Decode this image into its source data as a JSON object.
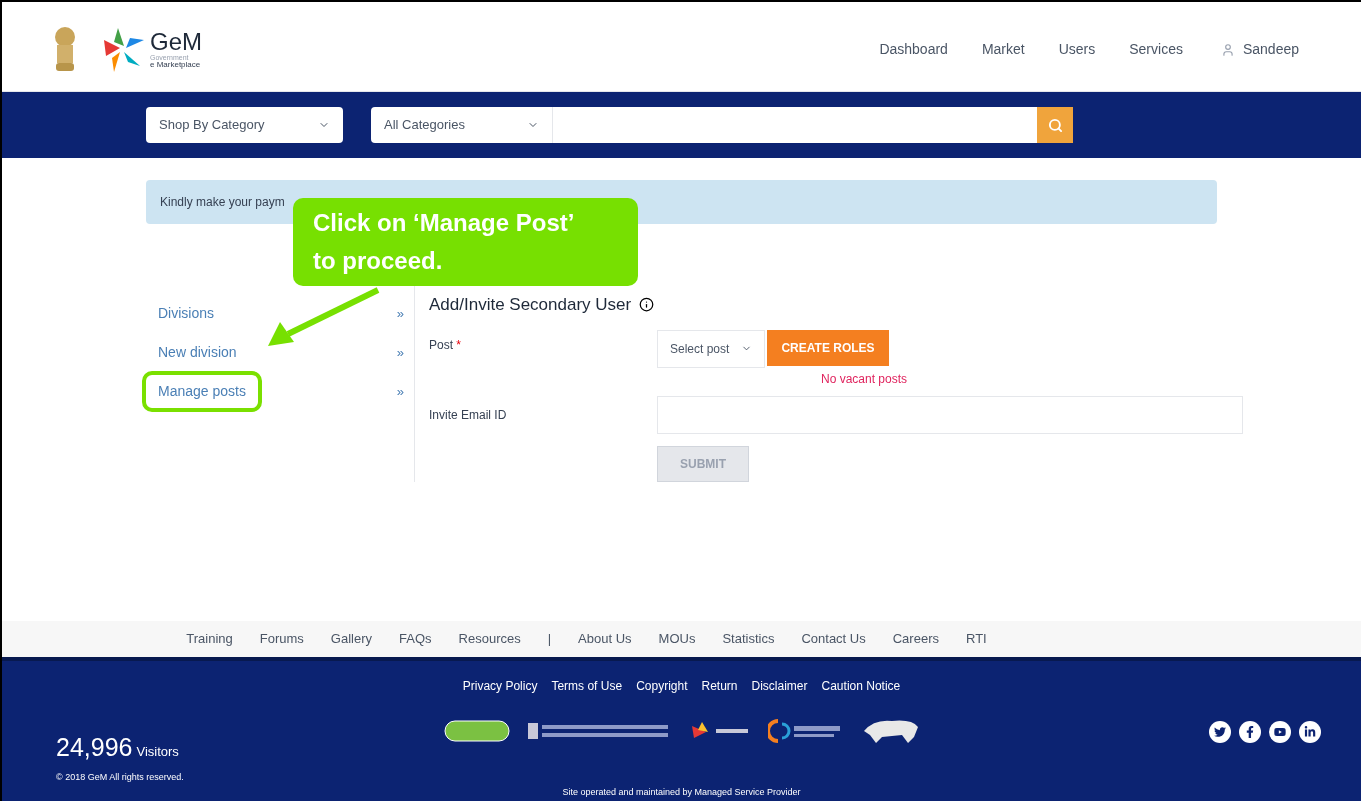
{
  "header": {
    "logo_title": "GeM",
    "logo_subtitle_1": "Government",
    "logo_subtitle_2": "e Marketplace",
    "nav": [
      "Dashboard",
      "Market",
      "Users",
      "Services"
    ],
    "user": "Sandeep"
  },
  "search_bar": {
    "category_dropdown": "Shop By Category",
    "filter_dropdown": "All Categories"
  },
  "notice": "Kindly make your paym",
  "callout": {
    "line_1": "Click on ‘Manage Post’",
    "line_2": "to proceed."
  },
  "sidebar": {
    "items": [
      {
        "label": "Divisions",
        "chevron": "»",
        "highlighted": false
      },
      {
        "label": "New division",
        "chevron": "»",
        "highlighted": false
      },
      {
        "label": "Manage posts",
        "chevron": "»",
        "highlighted": true
      }
    ]
  },
  "form": {
    "heading": "Add/Invite Secondary User",
    "post_label": "Post",
    "required_mark": "*",
    "post_select": "Select post",
    "create_button": "CREATE ROLES",
    "error": "No vacant posts",
    "email_label": "Invite Email ID",
    "submit_button": "SUBMIT"
  },
  "footer_links": [
    "Training",
    "Forums",
    "Gallery",
    "FAQs",
    "Resources",
    "|",
    "About Us",
    "MOUs",
    "Statistics",
    "Contact Us",
    "Careers",
    "RTI"
  ],
  "footer": {
    "policy_links": [
      "Privacy Policy",
      "Terms of Use",
      "Copyright",
      "Return",
      "Disclaimer",
      "Caution Notice"
    ],
    "visitor_count": "24,996",
    "visitor_label": "Visitors",
    "copyright": "© 2018 GeM All rights reserved.",
    "operated_by": "Site operated and maintained by Managed Service Provider"
  }
}
